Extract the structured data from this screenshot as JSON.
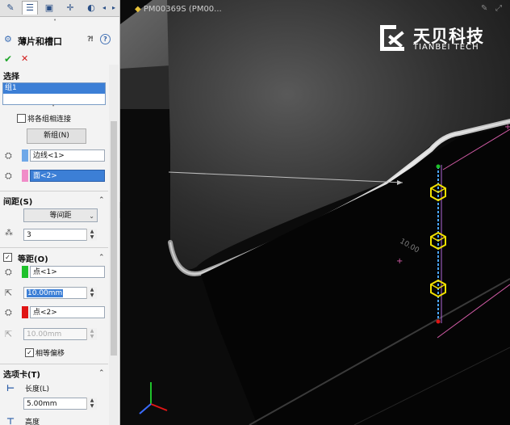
{
  "panel": {
    "title": "薄片和槽口",
    "help_glyph": "?",
    "ok_glyph": "✔",
    "cancel_glyph": "✕",
    "selection": {
      "label": "选择",
      "list_items": [
        "组1"
      ],
      "connect_groups_label": "将各组相连接",
      "new_group_label": "新组(N)",
      "edge_value": "边线<1>",
      "face_value": "面<2>"
    },
    "spacing": {
      "label": "间距(S)",
      "mode_value": "等间距",
      "count_value": "3"
    },
    "equal_distance": {
      "label": "等距(O)",
      "point1_value": "点<1>",
      "distance1_value": "10.00mm",
      "point2_value": "点<2>",
      "distance2_value": "10.00mm",
      "equal_offset_label": "相等偏移"
    },
    "tab_section": {
      "label": "选项卡(T)",
      "length_label": "长度(L)",
      "length_value": "5.00mm",
      "height_label": "高度"
    }
  },
  "viewport": {
    "doc_title": "PM00369S (PM00...",
    "logo_cn": "天贝科技",
    "logo_en": "TIANBEI TECH",
    "dim_label": "10.00"
  },
  "colors": {
    "accent": "#3c7fd6",
    "edge_swatch": "#6fa8e8",
    "face_swatch": "#f08cc8",
    "point1_swatch": "#1fc12b",
    "point2_swatch": "#e01515",
    "marker_yellow": "#f0e000"
  }
}
